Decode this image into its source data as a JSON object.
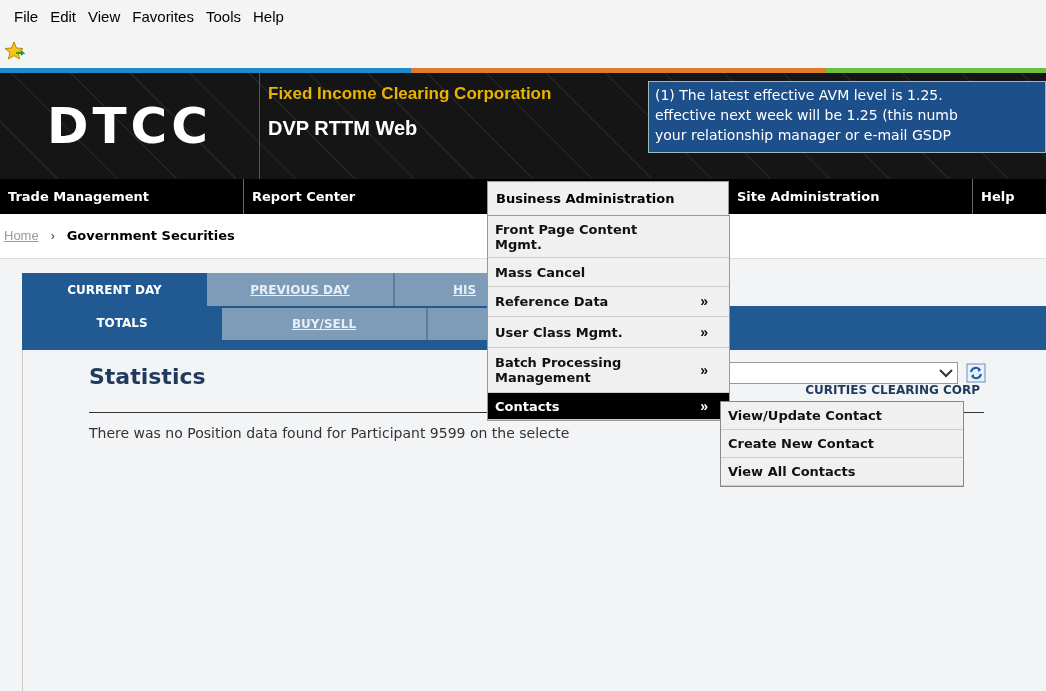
{
  "menu_bar": [
    "File",
    "Edit",
    "View",
    "Favorites",
    "Tools",
    "Help"
  ],
  "header": {
    "logo": "DTCC",
    "company": "Fixed Income Clearing Corporation",
    "app": "DVP RTTM Web",
    "notice": [
      "(1) The latest effective AVM level is 1.25.",
      "effective next week will be 1.25 (this numb",
      "your relationship manager or e-mail GSDP"
    ]
  },
  "nav": [
    {
      "label": "Trade Management",
      "selected": false
    },
    {
      "label": "Report Center",
      "selected": false
    },
    {
      "label": "Business Administration",
      "selected": true
    },
    {
      "label": "Site Administration",
      "selected": false
    },
    {
      "label": "Help",
      "selected": false
    }
  ],
  "breadcrumb": {
    "link": "Home",
    "separator": "›",
    "current": "Government Securities"
  },
  "tabs": [
    {
      "label": "CURRENT DAY",
      "selected": true
    },
    {
      "label": "PREVIOUS DAY",
      "selected": false
    },
    {
      "label": "HIS",
      "selected": false
    }
  ],
  "subtabs": [
    {
      "label": "TOTALS",
      "selected": true
    },
    {
      "label": "BUY/SELL",
      "selected": false
    },
    {
      "selected": false
    }
  ],
  "content": {
    "title": "Statistics",
    "participant": "CURITIES CLEARING CORP",
    "message": "There was no Position data found for Participant 9599 on the selecte"
  },
  "dropdown": [
    {
      "label": "Front Page Content Mgmt.",
      "submenu": false,
      "selected": false
    },
    {
      "label": "Mass Cancel",
      "submenu": false,
      "selected": false
    },
    {
      "label": "Reference Data",
      "submenu": true,
      "selected": false
    },
    {
      "label": "User Class Mgmt.",
      "submenu": true,
      "selected": false
    },
    {
      "label": "Batch Processing Management",
      "submenu": true,
      "selected": false
    },
    {
      "label": "Contacts",
      "submenu": true,
      "selected": true
    }
  ],
  "submenu_marker": "»",
  "submenu": [
    "View/Update Contact",
    "Create New Contact",
    "View All Contacts"
  ]
}
